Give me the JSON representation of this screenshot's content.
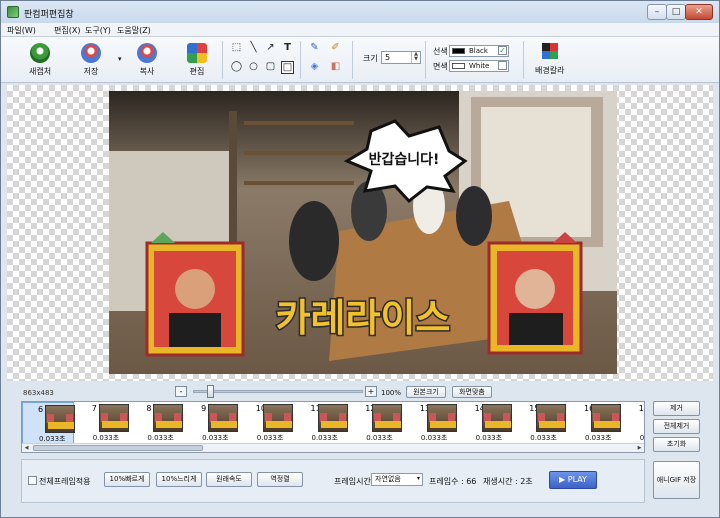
{
  "window": {
    "title": "판컴퍼편집창",
    "minimize": "–",
    "maximize": "□",
    "close": "✕"
  },
  "menu": [
    "파일(W)",
    "편집(X)",
    "도구(Y)",
    "도움말(Z)"
  ],
  "toolbar": {
    "new_frame": "새캡처",
    "save": "저장",
    "copy": "복사",
    "edit": "편집",
    "size_label": "크기",
    "size_value": "5",
    "line_label": "선색",
    "line_color_name": "Black",
    "fill_label": "면색",
    "fill_color_name": "White",
    "bg_label": "배경칼라",
    "line_color": "#000000",
    "fill_color": "#ffffff"
  },
  "image": {
    "speech_bubble": "반갑습니다!",
    "title_text": "카레라이스"
  },
  "zoom": {
    "size": "863x483",
    "minus": "-",
    "plus": "+",
    "percent": "100%",
    "original": "원본크기",
    "fit": "화면맞춤"
  },
  "frames": [
    {
      "num": "6",
      "dur": "0.033초"
    },
    {
      "num": "7",
      "dur": "0.033초"
    },
    {
      "num": "8",
      "dur": "0.033초"
    },
    {
      "num": "9",
      "dur": "0.033초"
    },
    {
      "num": "10",
      "dur": "0.033초"
    },
    {
      "num": "11",
      "dur": "0.033초"
    },
    {
      "num": "12",
      "dur": "0.033초"
    },
    {
      "num": "13",
      "dur": "0.033초"
    },
    {
      "num": "14",
      "dur": "0.033초"
    },
    {
      "num": "15",
      "dur": "0.033초"
    },
    {
      "num": "16",
      "dur": "0.033초"
    },
    {
      "num": "17",
      "dur": "0.033초"
    }
  ],
  "side": {
    "remove": "제거",
    "remove_all": "전체제거",
    "reset": "초기화",
    "save_gif": "애니GIF 저장"
  },
  "bottom": {
    "apply_all": "전체프레임적용",
    "faster": "10%빠르게",
    "slower": "10%느리게",
    "original_speed": "원래속도",
    "reverse": "역정렬",
    "frame_time_label": "프레임시간",
    "frame_time_value": "자연없음",
    "frame_count": "프레임수 : 66",
    "play_time": "재생시간 : 2초",
    "play": "▶ PLAY"
  }
}
